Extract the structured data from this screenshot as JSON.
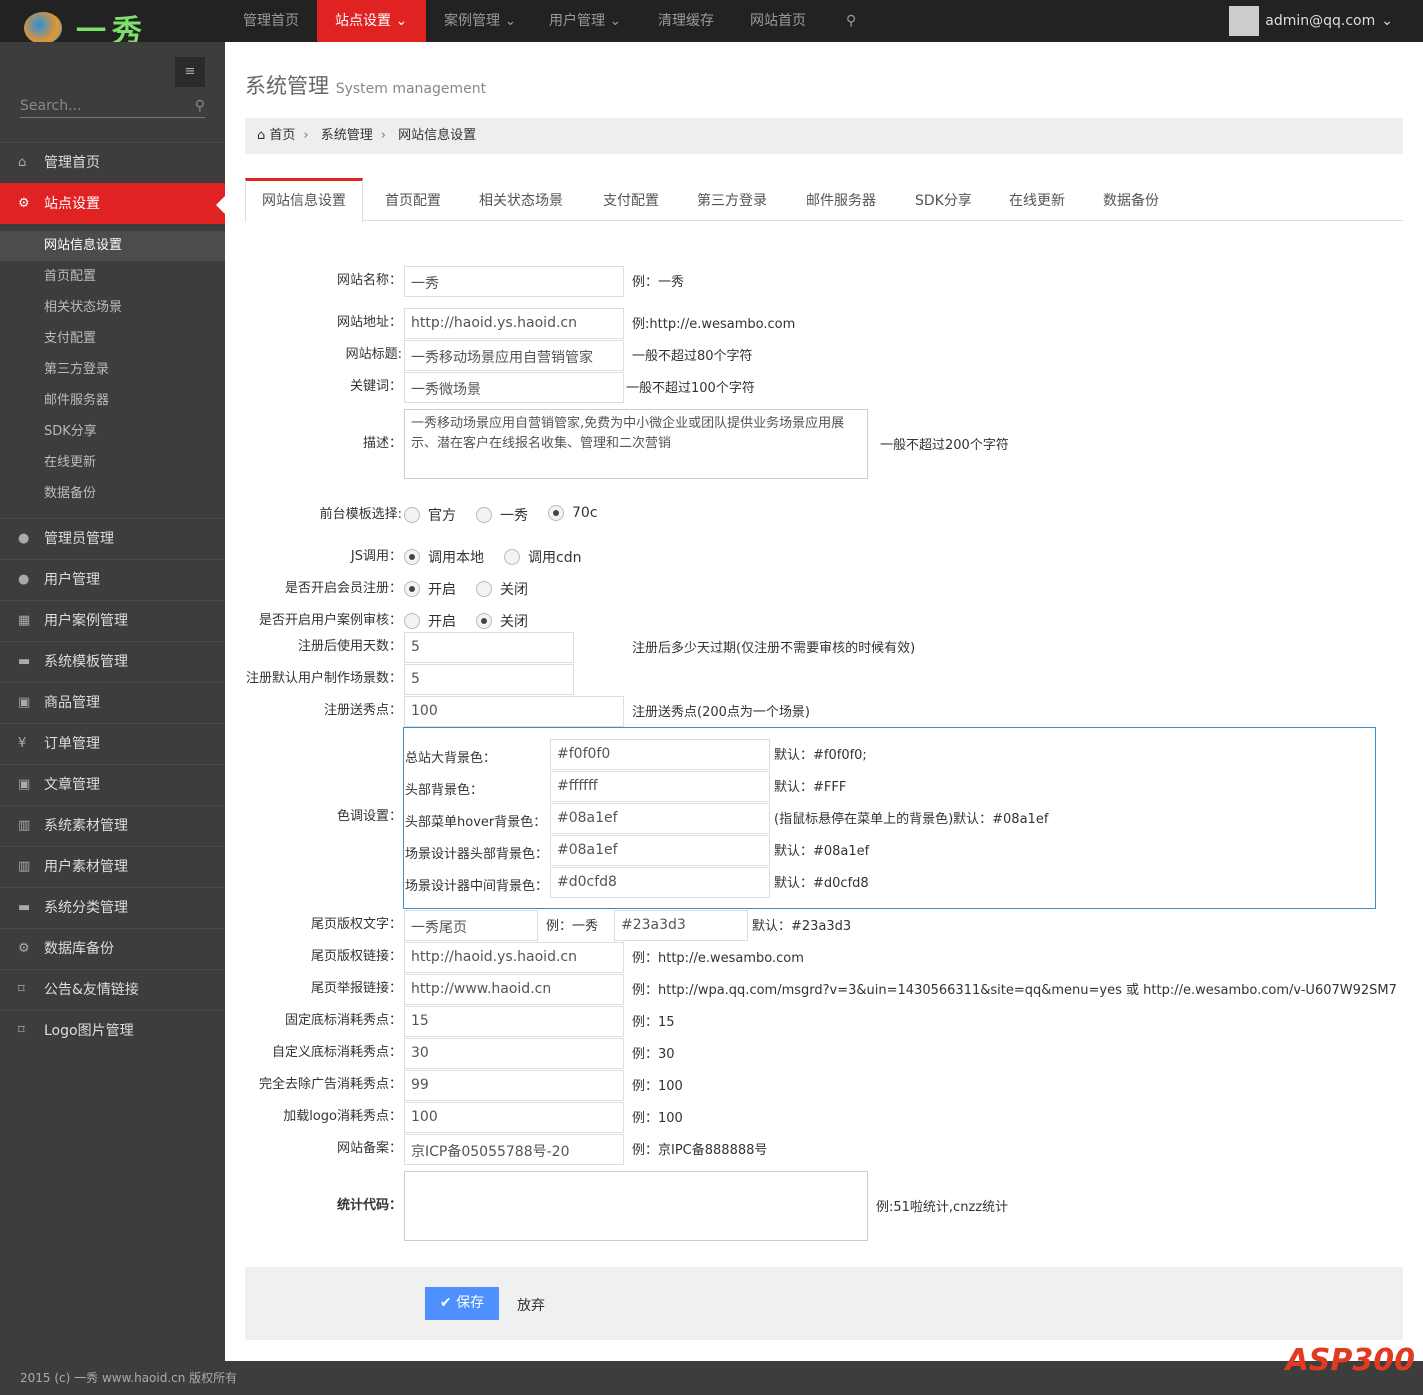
{
  "brand": {
    "name": "一秀"
  },
  "topnav": [
    {
      "label": "管理首页"
    },
    {
      "label": "站点设置 ⌄",
      "active": true
    },
    {
      "label": "案例管理 ⌄"
    },
    {
      "label": "用户管理 ⌄"
    },
    {
      "label": "清理缓存"
    },
    {
      "label": "网站首页"
    }
  ],
  "user": {
    "email": "admin@qq.com"
  },
  "sidebar": {
    "search_placeholder": "Search...",
    "items": [
      {
        "label": "管理首页",
        "icon": "home-icon",
        "g": "⌂"
      },
      {
        "label": "站点设置",
        "icon": "cogs-icon",
        "g": "⚙",
        "active": true
      },
      {
        "label": "管理员管理",
        "icon": "user-icon",
        "g": "●"
      },
      {
        "label": "用户管理",
        "icon": "user-icon",
        "g": "●"
      },
      {
        "label": "用户案例管理",
        "icon": "table-icon",
        "g": "▦"
      },
      {
        "label": "系统模板管理",
        "icon": "briefcase-icon",
        "g": "▬"
      },
      {
        "label": "商品管理",
        "icon": "box-icon",
        "g": "▣"
      },
      {
        "label": "订单管理",
        "icon": "yen-icon",
        "g": "¥"
      },
      {
        "label": "文章管理",
        "icon": "box-icon",
        "g": "▣"
      },
      {
        "label": "系统素材管理",
        "icon": "gift-icon",
        "g": "▥"
      },
      {
        "label": "用户素材管理",
        "icon": "gift-icon",
        "g": "▥"
      },
      {
        "label": "系统分类管理",
        "icon": "briefcase-icon",
        "g": "▬"
      },
      {
        "label": "数据库备份",
        "icon": "cogs-icon",
        "g": "⚙"
      },
      {
        "label": "公告&友情链接",
        "icon": "bookmark-icon",
        "g": "⌑"
      },
      {
        "label": "Logo图片管理",
        "icon": "bookmark-icon",
        "g": "⌑"
      }
    ],
    "subitems": [
      {
        "label": "网站信息设置",
        "active": true
      },
      {
        "label": "首页配置"
      },
      {
        "label": "相关状态场景"
      },
      {
        "label": "支付配置"
      },
      {
        "label": "第三方登录"
      },
      {
        "label": "邮件服务器"
      },
      {
        "label": "SDK分享"
      },
      {
        "label": "在线更新"
      },
      {
        "label": "数据备份"
      }
    ]
  },
  "page": {
    "title": "系统管理",
    "subtitle": "System management"
  },
  "breadcrumb": [
    "首页",
    "系统管理",
    "网站信息设置"
  ],
  "tabs": [
    "网站信息设置",
    "首页配置",
    "相关状态场景",
    "支付配置",
    "第三方登录",
    "邮件服务器",
    "SDK分享",
    "在线更新",
    "数据备份"
  ],
  "form": {
    "rows": [
      {
        "label": "网站名称：",
        "value": "一秀",
        "hint": "例：一秀"
      },
      {
        "label": "网站地址：",
        "value": "http://haoid.ys.haoid.cn",
        "hint": "例:http://e.wesambo.com"
      },
      {
        "label": "网站标题:",
        "value": "一秀移动场景应用自营销管家",
        "hint": "一般不超过80个字符"
      },
      {
        "label": "关键词：",
        "value": "一秀微场景",
        "hint": "一般不超过100个字符"
      },
      {
        "label": "描述：",
        "value": "一秀移动场景应用自营销管家,免费为中小微企业或团队提供业务场景应用展示、潜在客户在线报名收集、管理和二次营销",
        "hint": "一般不超过200个字符"
      },
      {
        "label": "前台模板选择:",
        "options": [
          "官方",
          "一秀",
          "70c"
        ],
        "selected": 2
      },
      {
        "label": "JS调用：",
        "options": [
          "调用本地",
          "调用cdn"
        ],
        "selected": 0
      },
      {
        "label": "是否开启会员注册：",
        "options": [
          "开启",
          "关闭"
        ],
        "selected": 0
      },
      {
        "label": "是否开启用户案例审核：",
        "options": [
          "开启",
          "关闭"
        ],
        "selected": 1
      },
      {
        "label": "注册后使用天数：",
        "value": "5",
        "hint": "注册后多少天过期(仅注册不需要审核的时候有效)"
      },
      {
        "label": "注册默认用户制作场景数：",
        "value": "5",
        "hint": ""
      },
      {
        "label": "注册送秀点：",
        "value": "100",
        "hint": "注册送秀点(200点为一个场景)"
      }
    ],
    "color_label": "色调设置：",
    "colors": [
      {
        "label": "总站大背景色：",
        "value": "#f0f0f0",
        "hint": "默认：#f0f0f0;"
      },
      {
        "label": "头部背景色：",
        "value": "#ffffff",
        "hint": "默认：#FFF"
      },
      {
        "label": "头部菜单hover背景色：",
        "value": "#08a1ef",
        "hint": "(指鼠标悬停在菜单上的背景色)默认：#08a1ef"
      },
      {
        "label": "场景设计器头部背景色：",
        "value": "#08a1ef",
        "hint": "默认：#08a1ef"
      },
      {
        "label": "场景设计器中间背景色：",
        "value": "#d0cfd8",
        "hint": "默认：#d0cfd8"
      }
    ],
    "footer_text": {
      "label": "尾页版权文字：",
      "value": "一秀尾页",
      "hint": "例：一秀",
      "color": "#23a3d3",
      "color_hint": "默认：#23a3d3"
    },
    "rows2": [
      {
        "label": "尾页版权链接：",
        "value": "http://haoid.ys.haoid.cn",
        "hint": "例：http://e.wesambo.com"
      },
      {
        "label": "尾页举报链接：",
        "value": "http://www.haoid.cn",
        "hint": "例：http://wpa.qq.com/msgrd?v=3&uin=1430566311&site=qq&menu=yes 或 http://e.wesambo.com/v-U607W92SM7"
      },
      {
        "label": "固定底标消耗秀点：",
        "value": "15",
        "hint": "例：15"
      },
      {
        "label": "自定义底标消耗秀点：",
        "value": "30",
        "hint": "例：30"
      },
      {
        "label": "完全去除广告消耗秀点：",
        "value": "99",
        "hint": "例：100"
      },
      {
        "label": "加载logo消耗秀点：",
        "value": "100",
        "hint": "例：100"
      },
      {
        "label": "网站备案：",
        "value": "京ICP备05055788号-20",
        "hint": "例：京IPC备888888号"
      }
    ],
    "stats": {
      "label": "统计代码：",
      "value": "",
      "hint": "例:51啦统计,cnzz统计"
    },
    "save_label": "✔ 保存",
    "cancel_label": "放弃"
  },
  "footer": "2015 (c) 一秀 www.haoid.cn 版权所有",
  "watermark": "ASP300"
}
